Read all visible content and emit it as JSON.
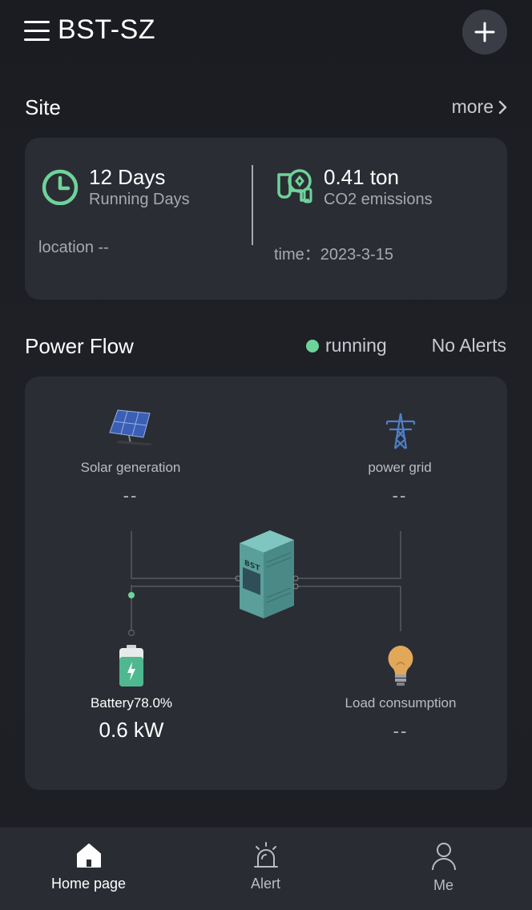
{
  "header": {
    "title": "BST-SZ"
  },
  "site": {
    "title": "Site",
    "more_label": "more",
    "running_days_value": "12 Days",
    "running_days_label": "Running Days",
    "co2_value": "0.41 ton",
    "co2_label": "CO2 emissions",
    "location": "location --",
    "time": "time：2023-3-15"
  },
  "power_flow": {
    "title": "Power Flow",
    "status": "running",
    "alerts": "No Alerts",
    "solar": {
      "label": "Solar generation",
      "value": "--"
    },
    "grid": {
      "label": "power grid",
      "value": "--"
    },
    "battery": {
      "label": "Battery78.0%",
      "value": "0.6 kW",
      "level_percent": 78.0
    },
    "load": {
      "label": "Load consumption",
      "value": "--"
    },
    "inverter_brand": "BST"
  },
  "nav": {
    "home": "Home page",
    "alert": "Alert",
    "me": "Me"
  },
  "colors": {
    "accent_green": "#6ed39a",
    "card_bg": "#2b2d34",
    "page_bg": "#1c1e23"
  }
}
